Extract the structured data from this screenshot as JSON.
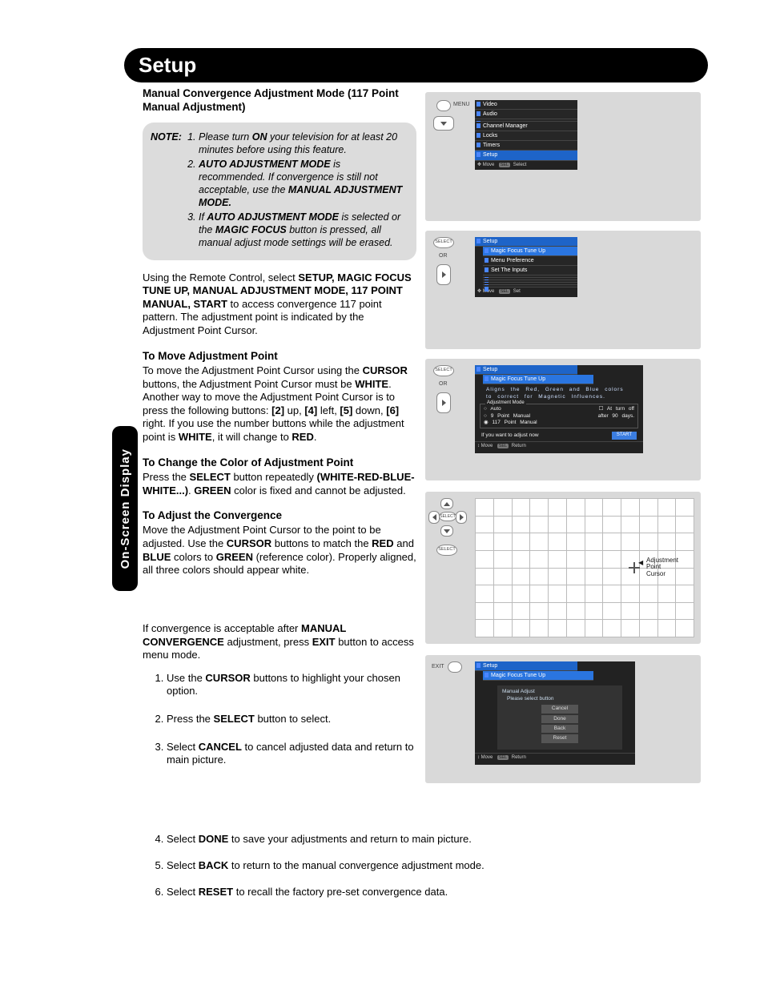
{
  "title": "Setup",
  "side_tab": "On-Screen Display",
  "heading": "Manual Convergence Adjustment Mode (117 Point Manual Adjustment)",
  "note": {
    "label": "NOTE:",
    "items": [
      "Please turn <b>ON</b> your television for at least 20 minutes before using this feature.",
      "<b>AUTO ADJUSTMENT MODE</b> is recommended. If convergence is still not acceptable, use the <b>MANUAL ADJUSTMENT MODE.</b>",
      "If <b>AUTO ADJUSTMENT MODE</b> is selected or the <b>MAGIC FOCUS</b> button is pressed, all manual adjust mode settings will be erased."
    ]
  },
  "intro": "Using the Remote Control, select <b>SETUP, MAGIC FOCUS TUNE UP, MANUAL ADJUSTMENT MODE, 117 POINT MANUAL, START</b> to access convergence 117 point pattern. The adjustment point is indicated by the Adjustment Point Cursor.",
  "sec1": {
    "h": "To Move Adjustment Point",
    "p": "To move the Adjustment Point Cursor using the <b>CURSOR</b> buttons, the Adjustment Point Cursor must be <b>WHITE</b>. Another way to move the Adjustment Point Cursor is to press the following buttons: <b>[2]</b> up, <b>[4]</b> left, <b>[5]</b> down, <b>[6]</b> right. If you use the number buttons while the adjustment point is <b>WHITE</b>, it will change to <b>RED</b>."
  },
  "sec2": {
    "h": "To Change the Color of Adjustment Point",
    "p": "Press the <b>SELECT</b> button repeatedly <b>(WHITE-RED-BLUE-WHITE...)</b>. <b>GREEN</b> color is fixed and cannot be adjusted."
  },
  "sec3": {
    "h": "To Adjust the Convergence",
    "p": "Move the Adjustment Point Cursor to the point to be adjusted. Use the <b>CURSOR</b> buttons to match the <b>RED</b> and <b>BLUE</b> colors to <b>GREEN</b> (reference color). Properly aligned, all three colors should appear white."
  },
  "after": "If convergence is acceptable after <b>MANUAL CONVERGENCE</b> adjustment, press <b>EXIT</b> button to access menu mode.",
  "steps_top": [
    "Use the <b>CURSOR</b> buttons to highlight your chosen option.",
    "Press the <b>SELECT</b> button to select.",
    "Select <b>CANCEL</b> to cancel adjusted data and return to main picture."
  ],
  "steps_wide": [
    "Select <b>DONE</b> to save your adjustments and return to main picture.",
    "Select <b>BACK</b> to return to the manual convergence adjustment mode.",
    "Select <b>RESET</b> to recall the factory pre-set convergence data."
  ],
  "remote": {
    "menu": "MENU",
    "select": "SELECT",
    "exit": "EXIT",
    "or": "OR"
  },
  "osd1": {
    "items": [
      "Video",
      "Audio",
      "",
      "Channel Manager",
      "Locks",
      "Timers",
      "Setup"
    ],
    "foot_move": "Move",
    "foot_sel": "Select",
    "sel_badge": "SEL"
  },
  "osd2": {
    "title": "Setup",
    "items": [
      "Magic Focus Tune Up",
      "Menu Preference",
      "Set The Inputs",
      "",
      "",
      "",
      "",
      ""
    ],
    "foot_move": "Move",
    "foot_set": "Set"
  },
  "osd3": {
    "title": "Setup",
    "sub": "Magic Focus Tune Up",
    "desc1": "Aligns the Red, Green and Blue colors",
    "desc2": "to correct for Magnetic Influences.",
    "mode_label": "Adjustment Mode",
    "opt_auto": "Auto",
    "opt_auto_r": "At turn off",
    "opt_9": "9 Point Manual",
    "opt_9_r": "after 90 days.",
    "opt_117": "117 Point Manual",
    "prompt": "If you want to adjust now",
    "start_btn": "START",
    "foot_move": "Move",
    "foot_ret": "Return"
  },
  "osd4": {
    "callout": "Adjustment Point Cursor"
  },
  "osd5": {
    "title": "Setup",
    "sub": "Magic Focus Tune Up",
    "panel_h": "Manual Adjust",
    "panel_msg": "Please select button",
    "buttons": [
      "Cancel",
      "Done",
      "Back",
      "Reset"
    ],
    "foot_move": "Move",
    "foot_ret": "Return"
  }
}
